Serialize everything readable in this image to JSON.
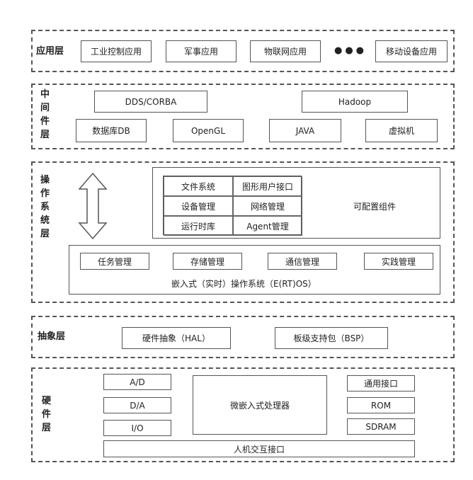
{
  "application_layer": {
    "label": "应用层",
    "items": [
      "工业控制应用",
      "军事应用",
      "物联网应用",
      "移动设备应用"
    ],
    "ellipsis": "●●●"
  },
  "middleware_layer": {
    "label": "中\n间\n件\n层",
    "items": [
      "DDS/CORBA",
      "Hadoop",
      "数据库DB",
      "OpenGL",
      "JAVA",
      "虚拟机"
    ]
  },
  "os_layer": {
    "label": "操\n作\n系\n统\n层",
    "components_grid": [
      "文件系统",
      "图形用户接口",
      "设备管理",
      "网络管理",
      "运行时库",
      "Agent管理"
    ],
    "configurable_label": "可配置组件",
    "kernel_items": [
      "任务管理",
      "存储管理",
      "通信管理",
      "实践管理"
    ],
    "kernel_label": "嵌入式（实时）操作系统（E(RT)OS）"
  },
  "abstraction_layer": {
    "label": "抽象层",
    "items": [
      "硬件抽象（HAL）",
      "板级支持包（BSP）"
    ]
  },
  "hardware_layer": {
    "label": "硬\n件\n层",
    "left_items": [
      "A/D",
      "D/A",
      "I/O"
    ],
    "processor": "微嵌入式处理器",
    "right_items": [
      "通用接口",
      "ROM",
      "SDRAM"
    ],
    "bottom": "人机交互接口"
  }
}
